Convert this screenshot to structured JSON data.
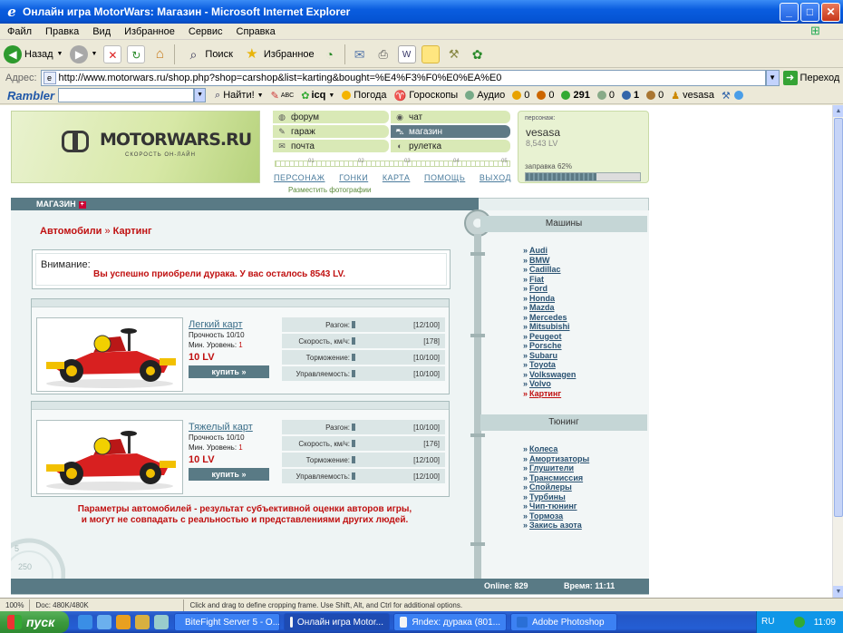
{
  "window": {
    "title": "Онлайн игра MotorWars: Магазин - Microsoft Internet Explorer",
    "minimize": "_",
    "maximize": "□",
    "close": "✕"
  },
  "menu": [
    "Файл",
    "Правка",
    "Вид",
    "Избранное",
    "Сервис",
    "Справка"
  ],
  "toolbar": {
    "back": "Назад",
    "search": "Поиск",
    "favorites": "Избранное"
  },
  "address": {
    "label": "Адрес:",
    "url": "http://www.motorwars.ru/shop.php?shop=carshop&list=karting&bought=%E4%F3%F0%E0%EA%E0",
    "go": "Переход"
  },
  "rambler": {
    "logo": "Rambler",
    "find": "Найти!",
    "weather": "Погода",
    "horoscope": "Гороскопы",
    "audio": "Аудио",
    "c1": "0",
    "c2": "0",
    "c3": "291",
    "c4": "0",
    "c5": "1",
    "c6": "0",
    "user": "vesasa"
  },
  "site": {
    "logo_text": "MOTORWARS.RU",
    "logo_sub": "СКОРОСТЬ ОН-ЛАЙН",
    "nav_left": [
      "форум",
      "гараж",
      "почта"
    ],
    "nav_right": [
      "чат",
      "магазин",
      "рулетка"
    ],
    "ruler_marks": [
      "01",
      "02",
      "03",
      "04",
      "05"
    ],
    "links": [
      "ПЕРСОНАЖ",
      "ГОНКИ",
      "КАРТА",
      "ПОМОЩЬ",
      "ВЫХОД"
    ],
    "photo_link": "Разместить фотографии",
    "player": {
      "label": "персонаж:",
      "name": "vesasa",
      "money": "8,543 LV",
      "fuel_label": "заправка 62%",
      "fuel_fraction": 0.62
    },
    "section_title": "МАГАЗИН",
    "breadcrumb": {
      "cars": "Автомобили",
      "sep": "»",
      "karting": "Картинг"
    },
    "alert": {
      "label": "Внимание:",
      "message": "Вы успешно приобрели дурака. У вас осталось 8543 LV."
    },
    "products": [
      {
        "name": "Легкий карт",
        "durability": "Прочность 10/10",
        "level_label": "Мин. Уровень:",
        "level": "1",
        "price": "10 LV",
        "buy": "купить »",
        "stats": [
          {
            "label": "Разгон:",
            "value": "[12/100]"
          },
          {
            "label": "Скорость, км/ч:",
            "value": "[178]"
          },
          {
            "label": "Торможение:",
            "value": "[10/100]"
          },
          {
            "label": "Управляемость:",
            "value": "[10/100]"
          }
        ]
      },
      {
        "name": "Тяжелый карт",
        "durability": "Прочность 10/10",
        "level_label": "Мин. Уровень:",
        "level": "1",
        "price": "10 LV",
        "buy": "купить »",
        "stats": [
          {
            "label": "Разгон:",
            "value": "[10/100]"
          },
          {
            "label": "Скорость, км/ч:",
            "value": "[176]"
          },
          {
            "label": "Торможение:",
            "value": "[12/100]"
          },
          {
            "label": "Управляемость:",
            "value": "[12/100]"
          }
        ]
      }
    ],
    "disclaimer_1": "Параметры автомобилей - результат субъективной оценки авторов игры,",
    "disclaimer_2": "и могут не совпадать с реальностью и представлениями других людей.",
    "cars_title": "Машины",
    "cars": [
      "Audi",
      "BMW",
      "Cadillac",
      "Fiat",
      "Ford",
      "Honda",
      "Mazda",
      "Mercedes",
      "Mitsubishi",
      "Peugeot",
      "Porsche",
      "Subaru",
      "Toyota",
      "Volkswagen",
      "Volvo",
      "Картинг"
    ],
    "tuning_title": "Тюнинг",
    "tuning": [
      "Колеса",
      "Амортизаторы",
      "Глушители",
      "Трансмиссия",
      "Спойлеры",
      "Турбины",
      "Чип-тюнинг",
      "Тормоза",
      "Закись азота"
    ],
    "online": "Online: 829",
    "time": "Время: 11:11",
    "gauge_a": "5",
    "gauge_b": "250"
  },
  "status": {
    "zoom": "100%",
    "doc": "Doc: 480K/480K",
    "hint": "Click and drag to define cropping frame. Use Shift, Alt, and Ctrl for additional options."
  },
  "taskbar": {
    "start": "пуск",
    "tasks": [
      "BiteFight Server 5 - О...",
      "Онлайн игра Motor...",
      "Яndex: дурака (801...",
      "Adobe Photoshop"
    ],
    "lang": "RU",
    "clock": "11:09"
  },
  "colors": {
    "accent": "#597a85",
    "red": "#c01010",
    "green_header": "#d7e8a6"
  }
}
